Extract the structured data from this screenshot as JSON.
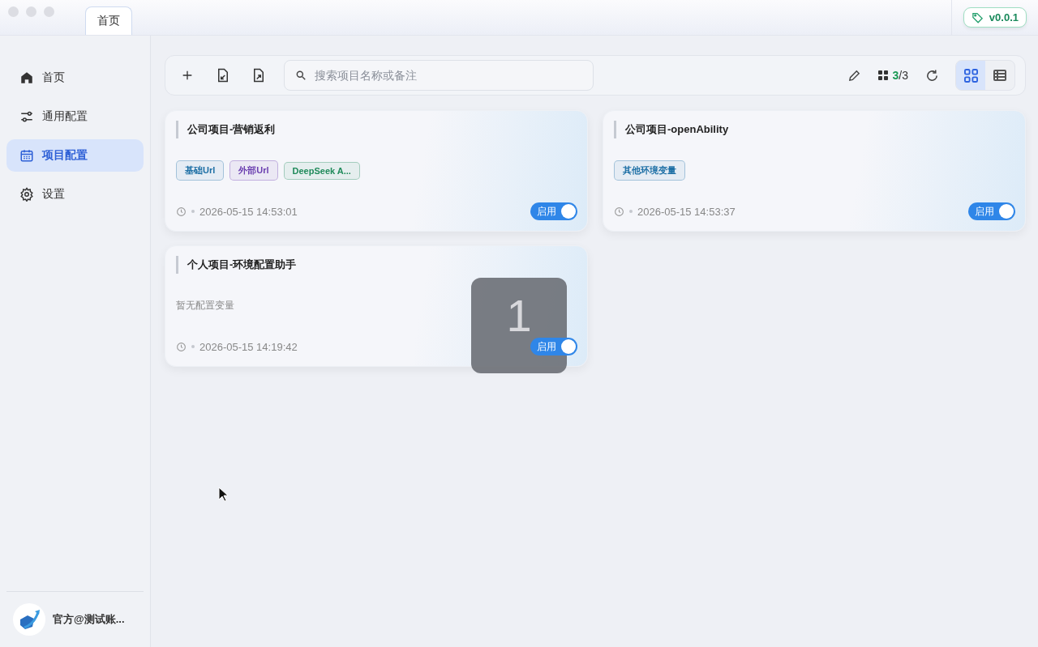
{
  "titlebar": {
    "tabs": [
      {
        "label": "首页",
        "selected": true
      }
    ],
    "version": "v0.0.1"
  },
  "sidebar": {
    "items": [
      {
        "label": "首页",
        "selected": false
      },
      {
        "label": "通用配置",
        "selected": false
      },
      {
        "label": "项目配置",
        "selected": true
      },
      {
        "label": "设置",
        "selected": false
      }
    ],
    "user": {
      "name": "官方@测试账..."
    }
  },
  "toolbar": {
    "search": {
      "placeholder": "搜索项目名称或备注"
    },
    "count_done": "3",
    "count_total": "/3",
    "views": [
      {
        "selected": true
      },
      {
        "selected": false
      }
    ]
  },
  "projects": [
    {
      "title": "公司项目-营销返利",
      "tags": [
        {
          "label": "基础Url",
          "color": "#1d6fa5"
        },
        {
          "label": "外部Url",
          "color": "#6b3fb0"
        },
        {
          "label": "DeepSeek A...",
          "color": "#1f8a5a"
        }
      ],
      "time": "2026-05-15 14:53:01",
      "status": "启用",
      "on": true
    },
    {
      "title": "公司项目-openAbility",
      "tags": [
        {
          "label": "其他环境变量",
          "color": "#1d6fa5"
        }
      ],
      "time": "2026-05-15 14:53:37",
      "status": "启用",
      "on": true
    },
    {
      "title": "个人项目-环境配置助手",
      "empty": "暂无配置变量",
      "time": "2026-05-15 14:19:42",
      "status": "启用",
      "on": true
    }
  ],
  "key_overlay": {
    "key": "1"
  }
}
